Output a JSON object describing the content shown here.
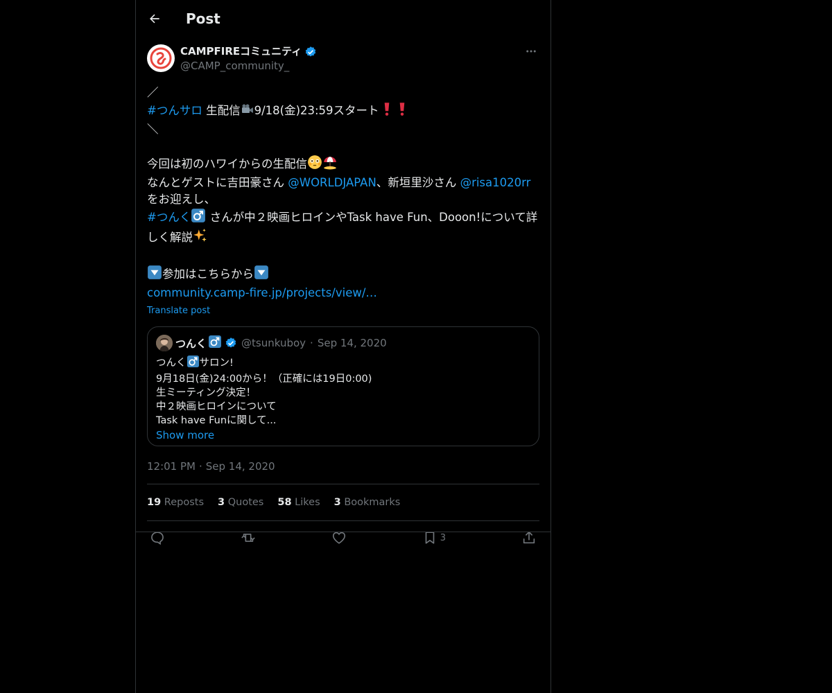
{
  "header": {
    "title": "Post"
  },
  "author": {
    "name": "CAMPFIREコミュニティ",
    "handle": "@CAMP_community_"
  },
  "post": {
    "line1": "／",
    "hashtag1": "#つんサロ",
    "line2_rest1": " 生配信",
    "line2_rest2": "9/18(金)23:59スタート",
    "line3": "＼",
    "line4": "今回は初のハワイからの生配信",
    "line5_a": "なんとゲストに吉田豪さん ",
    "mention1": "@WORLDJAPAN",
    "line5_b": "、新垣里沙さん ",
    "mention2": "@risa1020rr",
    "line6": "をお迎えし、",
    "hashtag2": "#つんく",
    "line7_rest": " さんが中２映画ヒロインやTask have Fun、Dooon!について詳",
    "line8": "しく解説",
    "line9": "参加はこちらから",
    "url": "community.camp-fire.jp/projects/view/…",
    "translate": "Translate post"
  },
  "quote": {
    "name": "つんく",
    "handle": "@tsunkuboy",
    "dot": "·",
    "date": "Sep 14, 2020",
    "lines": [
      "サロン!",
      "9月18日(金)24:00から！（正確には19日0:00)",
      "生ミーティング決定！",
      "中２映画ヒロインについて",
      "Task have Funに関して..."
    ],
    "line1_prefix": "つんく",
    "show_more": "Show more"
  },
  "meta": {
    "time": "12:01 PM",
    "sep": "·",
    "date": "Sep 14, 2020"
  },
  "stats": {
    "reposts_count": "19",
    "reposts_label": "Reposts",
    "quotes_count": "3",
    "quotes_label": "Quotes",
    "likes_count": "58",
    "likes_label": "Likes",
    "bookmarks_count": "3",
    "bookmarks_label": "Bookmarks"
  },
  "actions": {
    "bookmark_count": "3"
  },
  "colors": {
    "accent": "#1d9bf0",
    "muted": "#71767b",
    "text": "#e7e9ea",
    "border": "#2f3336"
  }
}
